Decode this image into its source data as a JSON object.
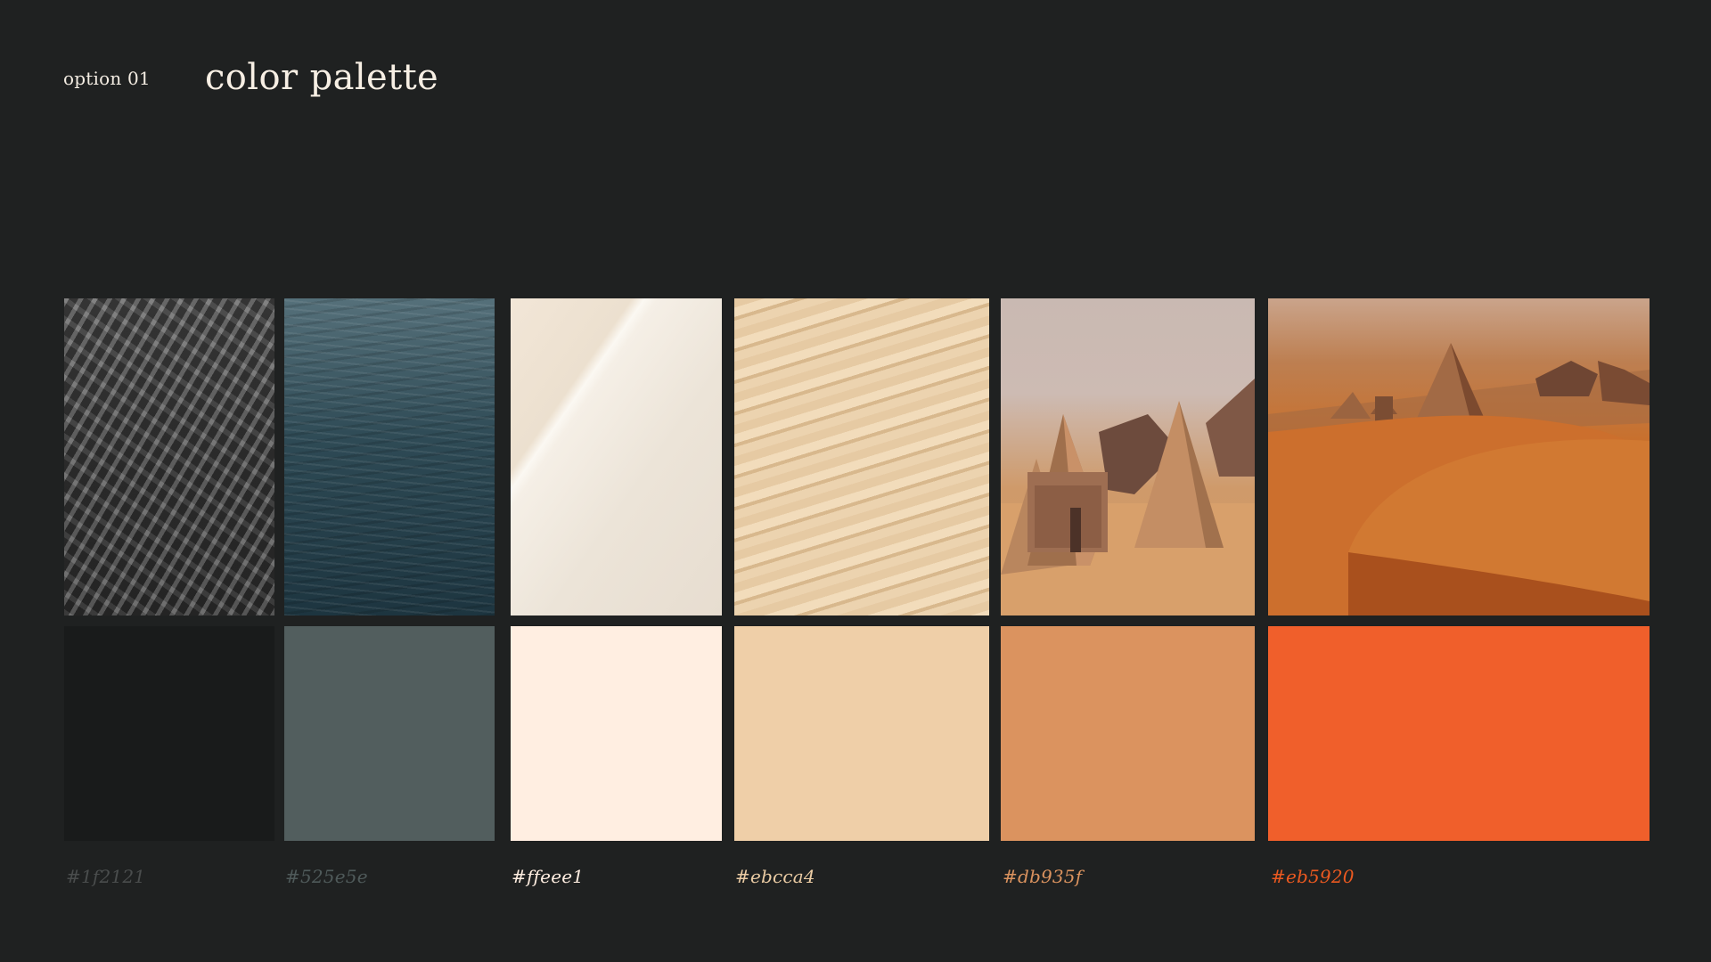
{
  "header": {
    "option_label": "option 01",
    "title": "color palette"
  },
  "palette": [
    {
      "hex_label": "#1f2121",
      "swatch_color": "#191b1b",
      "label_color": "#4a4d4d",
      "photo": "fish school, grayscale"
    },
    {
      "hex_label": "#525e5e",
      "swatch_color": "#525e5e",
      "label_color": "#4f5a5a",
      "photo": "dark ocean water"
    },
    {
      "hex_label": "#ffeee1",
      "swatch_color": "#ffeee1",
      "label_color": "#ffeee1",
      "photo": "white sand shoreline"
    },
    {
      "hex_label": "#ebcca4",
      "swatch_color": "#efcfa8",
      "label_color": "#ebcca4",
      "photo": "rippled sand dunes"
    },
    {
      "hex_label": "#db935f",
      "swatch_color": "#db935f",
      "label_color": "#db935f",
      "photo": "pyramids in desert"
    },
    {
      "hex_label": "#eb5920",
      "swatch_color": "#f05f2b",
      "label_color": "#eb5920",
      "photo": "pyramids on orange dunes"
    }
  ]
}
